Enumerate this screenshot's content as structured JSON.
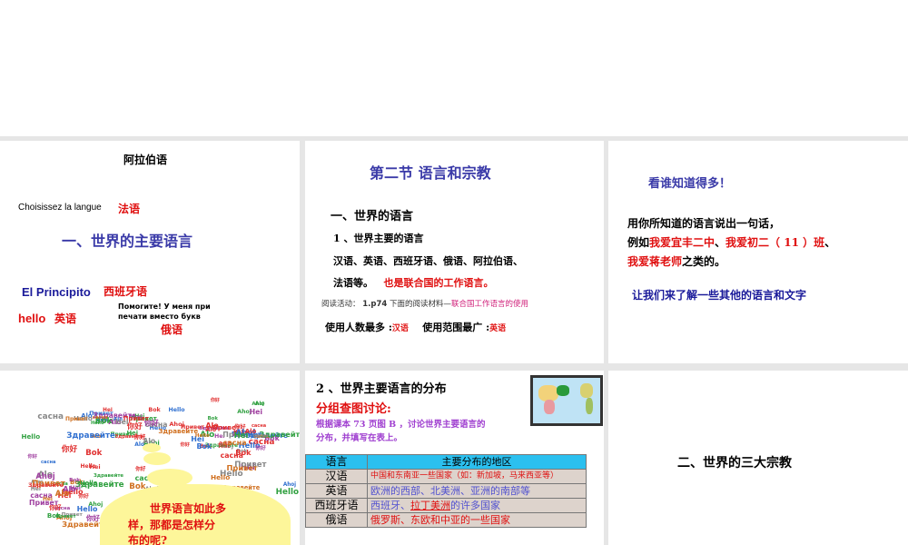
{
  "slide1": {
    "title": "阿拉伯语",
    "french": "Choisissez la langue",
    "french_label": "法语",
    "heading": "一、世界的主要语言",
    "spanish": "El Principito",
    "spanish_label": "西班牙语",
    "english": "hello",
    "english_label": "英语",
    "russian_line1": "Помогите! У меня при",
    "russian_line2": "печати вместо букв",
    "russian_label": "俄语"
  },
  "slide2": {
    "title": "第二节 语言和宗教",
    "h1": "一、世界的语言",
    "h2": "1 、世界主要的语言",
    "line1": "汉语、英语、西班牙语、俄语、阿拉伯语、",
    "line2a": "法语等。",
    "line2b": "也是联合国的工作语言。",
    "reading_a": "阅读活动：",
    "reading_b": "1.p74",
    "reading_c": "下面的阅读材料—",
    "reading_d": "联合国工作语言的使用",
    "most_users": "使用人数最多 :",
    "most_users_val": "汉语",
    "widest": "使用范围最广 :",
    "widest_val": "英语"
  },
  "slide3": {
    "title": "看谁知道得多！",
    "p1": "用你所知道的语言说出一句话，",
    "p2a": "例如",
    "p2b": "我爱宜丰二中",
    "p2c": "、",
    "p2d": "我爱初二（ 11 ）班",
    "p2e": "、",
    "p3a": "我爱蒋老师",
    "p3b": "之类的。",
    "bottom": "让我们来了解一些其他的语言和文字"
  },
  "slide4": {
    "words": [
      "Hello",
      "你好",
      "Привет",
      "Alo",
      "Bok",
      "сасна",
      "Ahoj",
      "Hei",
      "Здравейте"
    ],
    "cloud_line1": "世界语言如此多",
    "cloud_line2": "样，那都是怎样分",
    "cloud_line3": "布的呢?"
  },
  "slide5": {
    "title": "2 、世界主要语言的分布",
    "subtitle": "分组查图讨论:",
    "instr1": "根据课本 73 页图 B ，讨论世界主要语言的",
    "instr2": "分布，并填写在表上。",
    "headers": [
      "语言",
      "主要分布的地区"
    ],
    "rows": [
      {
        "lang": "汉语",
        "region": "中国和东南亚一些国家（如：新加坡，马来西亚等）"
      },
      {
        "lang": "英语",
        "region": "欧洲的西部、北美洲、亚洲的南部等"
      },
      {
        "lang": "西班牙语",
        "region_a": "西班牙、",
        "region_b": "拉丁美洲",
        "region_c": "的许多国家"
      },
      {
        "lang": "俄语",
        "region": "俄罗斯、东欧和中亚的一些国家"
      }
    ]
  },
  "slide6": {
    "title": "二、世界的三大宗教"
  }
}
